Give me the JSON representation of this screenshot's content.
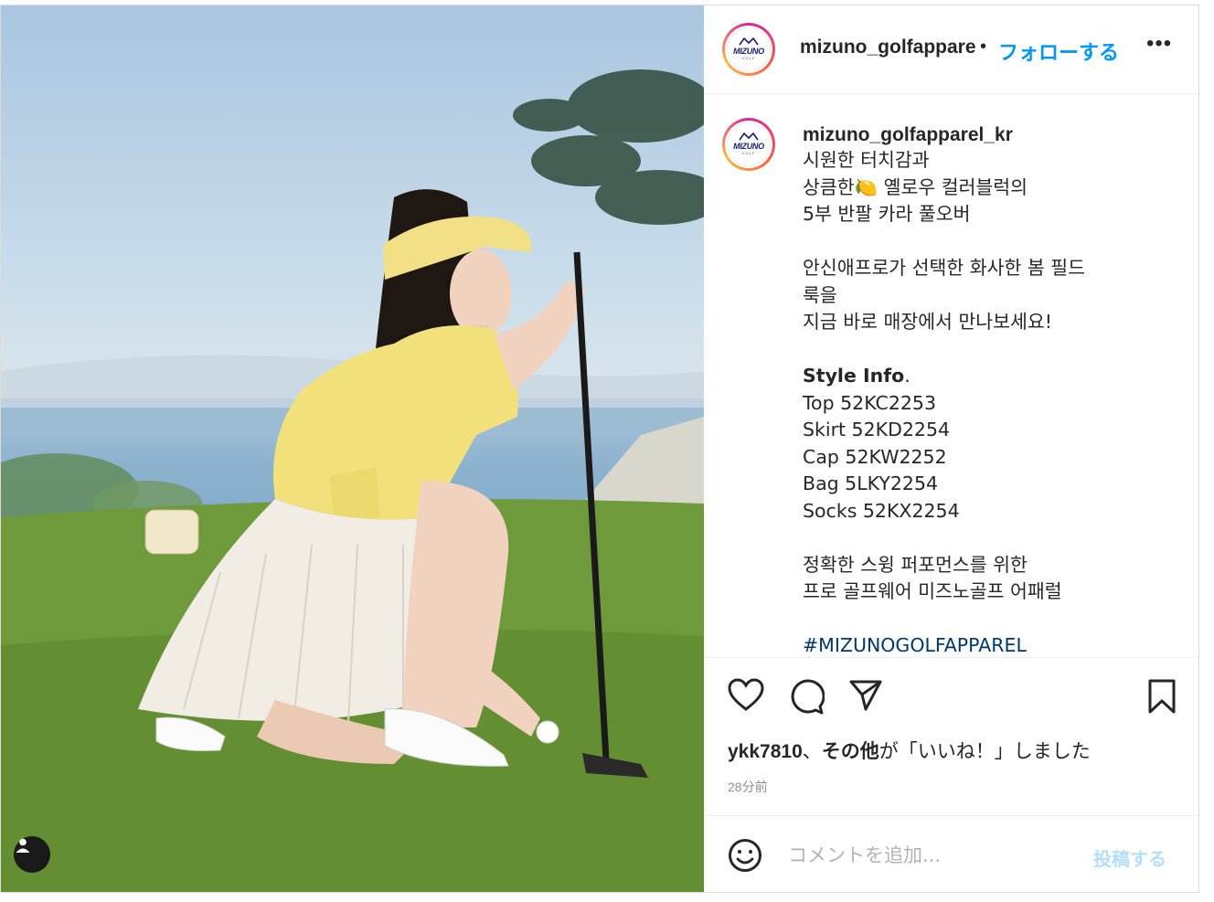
{
  "header": {
    "username": "mizuno_golfapparel_kr",
    "separator": "•",
    "follow_label": "フォローする",
    "more_icon": "more-horizontal-icon"
  },
  "avatar": {
    "logo_word": "MIZUNO",
    "logo_sub": "GOLF"
  },
  "caption": {
    "username": "mizuno_golfapparel_kr",
    "lines": [
      "시원한 터치감과",
      "상큼한🍋 옐로우 컬러블럭의",
      "5부 반팔 카라 풀오버",
      "",
      "안신애프로가 선택한 화사한 봄 필드",
      "룩을",
      "지금 바로 매장에서 만나보세요!",
      ""
    ],
    "style_info_label": "Style Info",
    "style_info_period": ".",
    "style_items": [
      "Top 52KC2253",
      "Skirt 52KD2254",
      "Cap 52KW2252",
      "Bag 5LKY2254",
      "Socks 52KX2254"
    ],
    "closing_lines": [
      "정확한 스윙 퍼포먼스를 위한",
      "프로 골프웨어 미즈노골프 어패럴"
    ],
    "hashtag": "#MIZUNOGOLFAPPAREL"
  },
  "actions": {
    "like_icon": "heart-icon",
    "comment_icon": "comment-icon",
    "share_icon": "send-icon",
    "save_icon": "bookmark-icon"
  },
  "likes": {
    "user": "ykk7810",
    "separator": "、",
    "others": "その他",
    "suffix": "が「いいね！」しました"
  },
  "timestamp": "28分前",
  "comment": {
    "placeholder": "コメントを追加...",
    "post_label": "投稿する",
    "emoji_icon": "emoji-icon"
  },
  "photo": {
    "tag_icon": "user-tag-icon"
  },
  "colors": {
    "link_blue": "#0095f6",
    "post_disabled": "#b2dffc",
    "hashtag": "#00376b"
  }
}
